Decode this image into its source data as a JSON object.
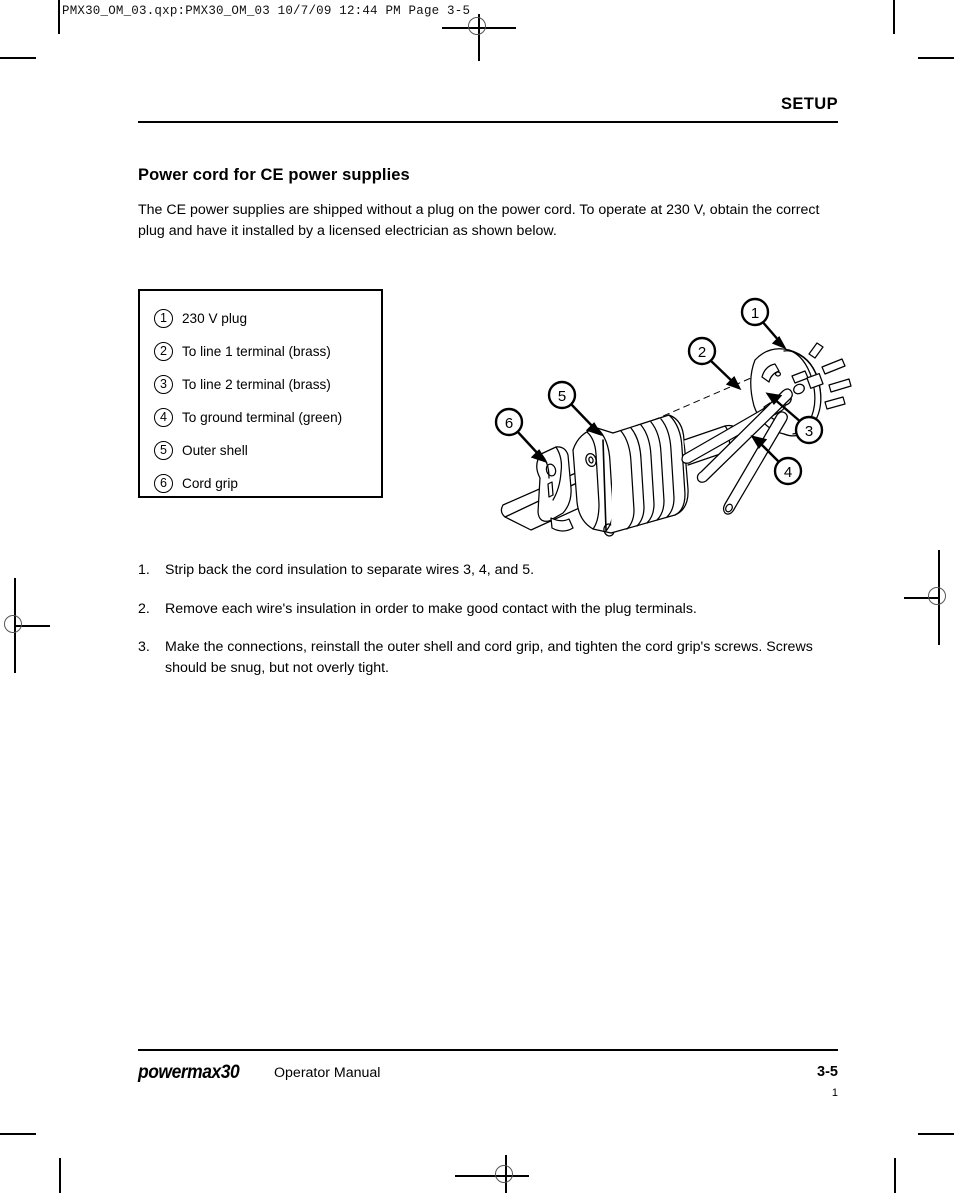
{
  "prepress": {
    "slug": "PMX30_OM_03.qxp:PMX30_OM_03  10/7/09  12:44 PM  Page 3-5"
  },
  "header": {
    "running_head": "SETUP"
  },
  "content": {
    "section_title": "Power cord for CE power supplies",
    "intro": "The CE power supplies are shipped without a plug on the power cord. To operate at 230 V, obtain the correct plug and have it installed by a licensed electrician as shown below."
  },
  "legend": {
    "items": [
      {
        "num": "1",
        "label": "230 V plug"
      },
      {
        "num": "2",
        "label": "To line 1 terminal (brass)"
      },
      {
        "num": "3",
        "label": "To line 2 terminal (brass)"
      },
      {
        "num": "4",
        "label": "To ground terminal (green)"
      },
      {
        "num": "5",
        "label": "Outer shell"
      },
      {
        "num": "6",
        "label": "Cord grip"
      }
    ]
  },
  "figure": {
    "alt": "Exploded view of a 230 V CE plug, three wires, outer shell and cord grip",
    "callouts": [
      {
        "num": "1",
        "target": "230 V plug body"
      },
      {
        "num": "2",
        "target": "line 1 wire"
      },
      {
        "num": "3",
        "target": "line 2 wire"
      },
      {
        "num": "4",
        "target": "ground wire"
      },
      {
        "num": "5",
        "target": "outer shell"
      },
      {
        "num": "6",
        "target": "cord grip"
      }
    ]
  },
  "steps": [
    {
      "num": "1.",
      "text": "Strip back the cord insulation to separate wires 3, 4, and 5."
    },
    {
      "num": "2.",
      "text": "Remove each wire's insulation in order to make good contact with the plug terminals."
    },
    {
      "num": "3.",
      "text": "Make the connections, reinstall the outer shell and cord grip, and tighten the cord grip's screws. Screws should be snug, but not overly tight."
    }
  ],
  "footer": {
    "logo": "powermax30",
    "manual": "Operator Manual",
    "page_number": "3-5",
    "folio": "1"
  }
}
